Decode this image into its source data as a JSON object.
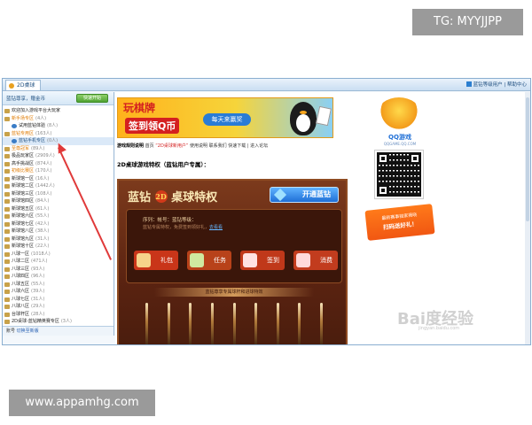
{
  "watermarks": {
    "top": "TG: MYYJJPP",
    "bottom": "www.appamhg.com"
  },
  "window": {
    "tab_label": "2D桌球",
    "top_right_link": "蓝钻等级用户 | 帮助中心"
  },
  "sidebar": {
    "user_text": "蓝钻尊享，赠金币",
    "quick_button": "快速开始",
    "items": [
      {
        "label": "欢迎加入游戏平台大玩家",
        "count": "",
        "level": 0,
        "style": "normal"
      },
      {
        "label": "新手场专区",
        "count": "(4人)",
        "level": 0,
        "style": "orange"
      },
      {
        "label": "试用蓝钻体验",
        "count": "(8人)",
        "level": 1,
        "style": "normal"
      },
      {
        "label": "蓝钻专用区",
        "count": "(163人)",
        "level": 0,
        "style": "orange"
      },
      {
        "label": "蓝钻手机专区",
        "count": "(0人)",
        "level": 1,
        "style": "sel"
      },
      {
        "label": "至尊冠军",
        "count": "(89人)",
        "level": 0,
        "style": "orange"
      },
      {
        "label": "极品玩家区",
        "count": "(2909人)",
        "level": 0,
        "style": "normal"
      },
      {
        "label": "高手挑战区",
        "count": "(874人)",
        "level": 0,
        "style": "normal"
      },
      {
        "label": "初级比赛区",
        "count": "(170人)",
        "level": 0,
        "style": "orange"
      },
      {
        "label": "新球馆一区",
        "count": "(16人)",
        "level": 0,
        "style": "normal"
      },
      {
        "label": "新球馆二区",
        "count": "(1442人)",
        "level": 0,
        "style": "normal"
      },
      {
        "label": "新球馆三区",
        "count": "(108人)",
        "level": 0,
        "style": "normal"
      },
      {
        "label": "新球馆四区",
        "count": "(84人)",
        "level": 0,
        "style": "normal"
      },
      {
        "label": "新球馆五区",
        "count": "(61人)",
        "level": 0,
        "style": "normal"
      },
      {
        "label": "新球馆六区",
        "count": "(55人)",
        "level": 0,
        "style": "normal"
      },
      {
        "label": "新球馆七区",
        "count": "(42人)",
        "level": 0,
        "style": "normal"
      },
      {
        "label": "新球馆八区",
        "count": "(38人)",
        "level": 0,
        "style": "normal"
      },
      {
        "label": "新球馆九区",
        "count": "(31人)",
        "level": 0,
        "style": "normal"
      },
      {
        "label": "新球馆十区",
        "count": "(22人)",
        "level": 0,
        "style": "normal"
      },
      {
        "label": "八球一区",
        "count": "(1018人)",
        "level": 0,
        "style": "normal"
      },
      {
        "label": "八球二区",
        "count": "(471人)",
        "level": 0,
        "style": "normal"
      },
      {
        "label": "八球三区",
        "count": "(93人)",
        "level": 0,
        "style": "normal"
      },
      {
        "label": "八球四区",
        "count": "(96人)",
        "level": 0,
        "style": "normal"
      },
      {
        "label": "八球五区",
        "count": "(55人)",
        "level": 0,
        "style": "normal"
      },
      {
        "label": "八球六区",
        "count": "(39人)",
        "level": 0,
        "style": "normal"
      },
      {
        "label": "八球七区",
        "count": "(31人)",
        "level": 0,
        "style": "normal"
      },
      {
        "label": "八球八区",
        "count": "(29人)",
        "level": 0,
        "style": "normal"
      },
      {
        "label": "台球杆区",
        "count": "(28人)",
        "level": 0,
        "style": "normal"
      },
      {
        "label": "2D桌球-蓝钻精英赛专区",
        "count": "(3人)",
        "level": 0,
        "style": "normal"
      }
    ],
    "footer_text": "账号",
    "footer_link": "切换至新版"
  },
  "content": {
    "banner": {
      "line1": "玩棋牌",
      "line2": "签到领Q币",
      "cta": "每天来赢奖"
    },
    "subnav": {
      "label": "游戏规则说明",
      "link1": "首页",
      "red": "“2D桌球新用户”",
      "link2": "使用说明",
      "link3": "联系我们",
      "tail": "快速下载 | 进入论坛"
    },
    "description": "2D桌球游戏特权（蓝钻用户专属）：",
    "vip": {
      "title_prefix": "蓝钻",
      "title_num": "2D",
      "title_suffix": "桌球特权",
      "open_button": "开通蓝钻",
      "info_line": "序列：帐号：蓝钻等级：",
      "info_sub": "蓝钻专属特权，免费签到领好礼，",
      "info_link": "去看看",
      "buttons": [
        "礼包",
        "任务",
        "签到",
        "消费"
      ],
      "strip": "蓝钻尊享专属球杆和进球特效",
      "cue_count": 9
    },
    "side": {
      "brand": "QQ游戏",
      "brand_sub": "QQGAME.QQ.COM",
      "promo_line1": "最新赛事独家揭晓",
      "promo_line2": "扫码送好礼！"
    },
    "baidu_mark": "Bai度经验",
    "baidu_sub": "jingyan.baidu.com"
  }
}
